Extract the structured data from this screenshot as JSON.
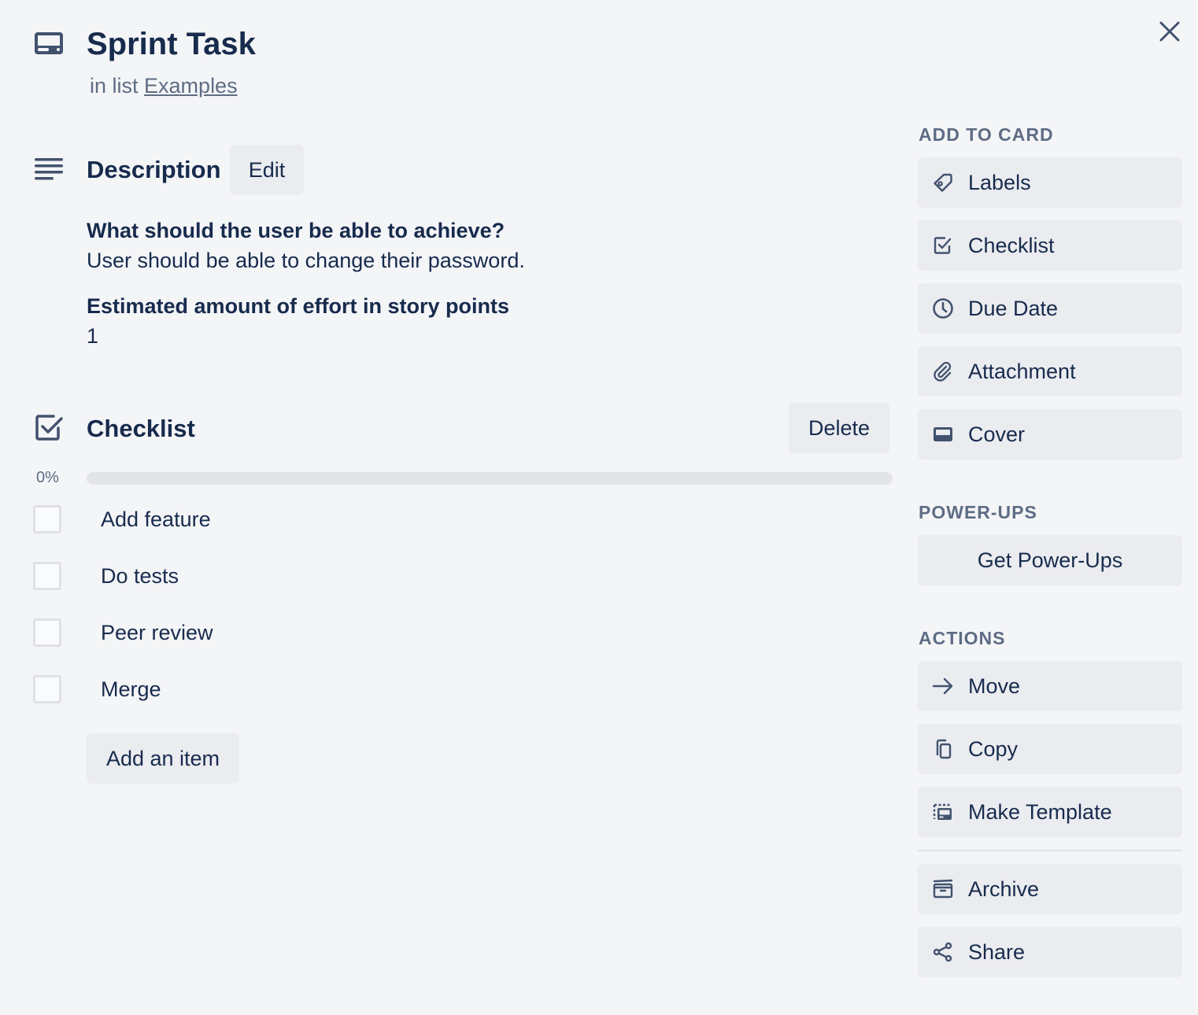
{
  "header": {
    "title": "Sprint Task",
    "subtitle_prefix": "in list",
    "list_name": "Examples"
  },
  "description": {
    "title": "Description",
    "edit_label": "Edit",
    "blocks": [
      {
        "heading": "What should the user be able to achieve?",
        "text": "User should be able to change their password."
      },
      {
        "heading": "Estimated amount of effort in story points",
        "text": "1"
      }
    ]
  },
  "checklist": {
    "title": "Checklist",
    "delete_label": "Delete",
    "progress_label": "0%",
    "progress_fraction": 0,
    "items": [
      {
        "label": "Add feature",
        "checked": false
      },
      {
        "label": "Do tests",
        "checked": false
      },
      {
        "label": "Peer review",
        "checked": false
      },
      {
        "label": "Merge",
        "checked": false
      }
    ],
    "add_item_label": "Add an item"
  },
  "sidebar": {
    "add_to_card": {
      "heading": "ADD TO CARD",
      "items": [
        {
          "label": "Labels",
          "icon": "tag-icon"
        },
        {
          "label": "Checklist",
          "icon": "checkbox-icon"
        },
        {
          "label": "Due Date",
          "icon": "clock-icon"
        },
        {
          "label": "Attachment",
          "icon": "paperclip-icon"
        },
        {
          "label": "Cover",
          "icon": "cover-icon"
        }
      ]
    },
    "power_ups": {
      "heading": "POWER-UPS",
      "button_label": "Get Power-Ups"
    },
    "actions": {
      "heading": "ACTIONS",
      "items": [
        {
          "label": "Move",
          "icon": "arrow-right-icon"
        },
        {
          "label": "Copy",
          "icon": "copy-icon"
        },
        {
          "label": "Make Template",
          "icon": "template-icon"
        },
        {
          "label": "Archive",
          "icon": "archive-icon"
        },
        {
          "label": "Share",
          "icon": "share-icon"
        }
      ]
    }
  },
  "colors": {
    "background": "#f4f5f7",
    "button_bg": "#ebecf0",
    "text_primary": "#172b4d",
    "text_secondary": "#5e6c84",
    "icon": "#42526e"
  }
}
